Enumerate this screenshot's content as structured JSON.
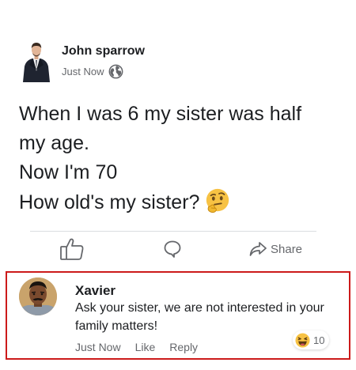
{
  "post": {
    "author": "John sparrow",
    "timestamp": "Just Now",
    "privacy_icon": "globe-icon",
    "lines": [
      "When I was 6 my sister was half",
      "my age.",
      "Now I'm 70",
      "How old's my sister?"
    ],
    "emoji": "thinking-face-icon"
  },
  "actions": {
    "like_icon": "thumbs-up-icon",
    "comment_icon": "comment-bubble-icon",
    "share_label": "Share"
  },
  "comment": {
    "author": "Xavier",
    "text": "Ask your sister, we are not interested in your family matters!",
    "timestamp": "Just Now",
    "like_label": "Like",
    "reply_label": "Reply",
    "reaction_count": "10",
    "reaction_icon": "haha-emoji-icon"
  },
  "colors": {
    "highlight_border": "#cc1a1a",
    "secondary_text": "#65676b",
    "primary_text": "#1c1e21"
  }
}
